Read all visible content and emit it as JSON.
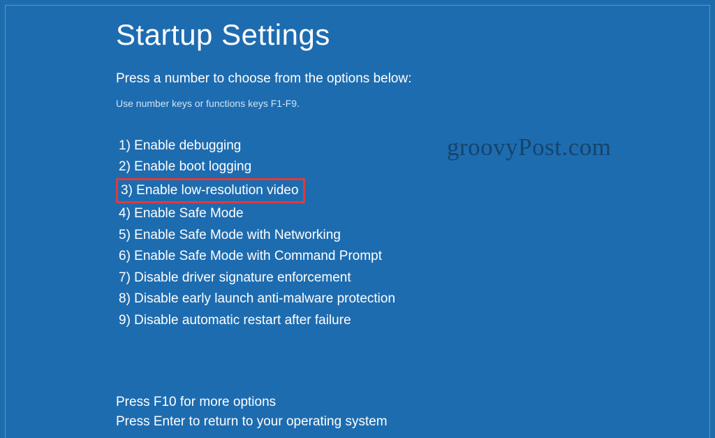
{
  "title": "Startup Settings",
  "subtitle": "Press a number to choose from the options below:",
  "hint": "Use number keys or functions keys F1-F9.",
  "options": [
    "1) Enable debugging",
    "2) Enable boot logging",
    "3) Enable low-resolution video",
    "4) Enable Safe Mode",
    "5) Enable Safe Mode with Networking",
    "6) Enable Safe Mode with Command Prompt",
    "7) Disable driver signature enforcement",
    "8) Disable early launch anti-malware protection",
    "9) Disable automatic restart after failure"
  ],
  "highlighted_index": 2,
  "footer": {
    "line1": "Press F10 for more options",
    "line2": "Press Enter to return to your operating system"
  },
  "watermark": "groovyPost.com",
  "colors": {
    "background": "#1e6cb0",
    "text": "#ffffff",
    "highlight_border": "#e03a3a",
    "watermark": "#15446c"
  }
}
